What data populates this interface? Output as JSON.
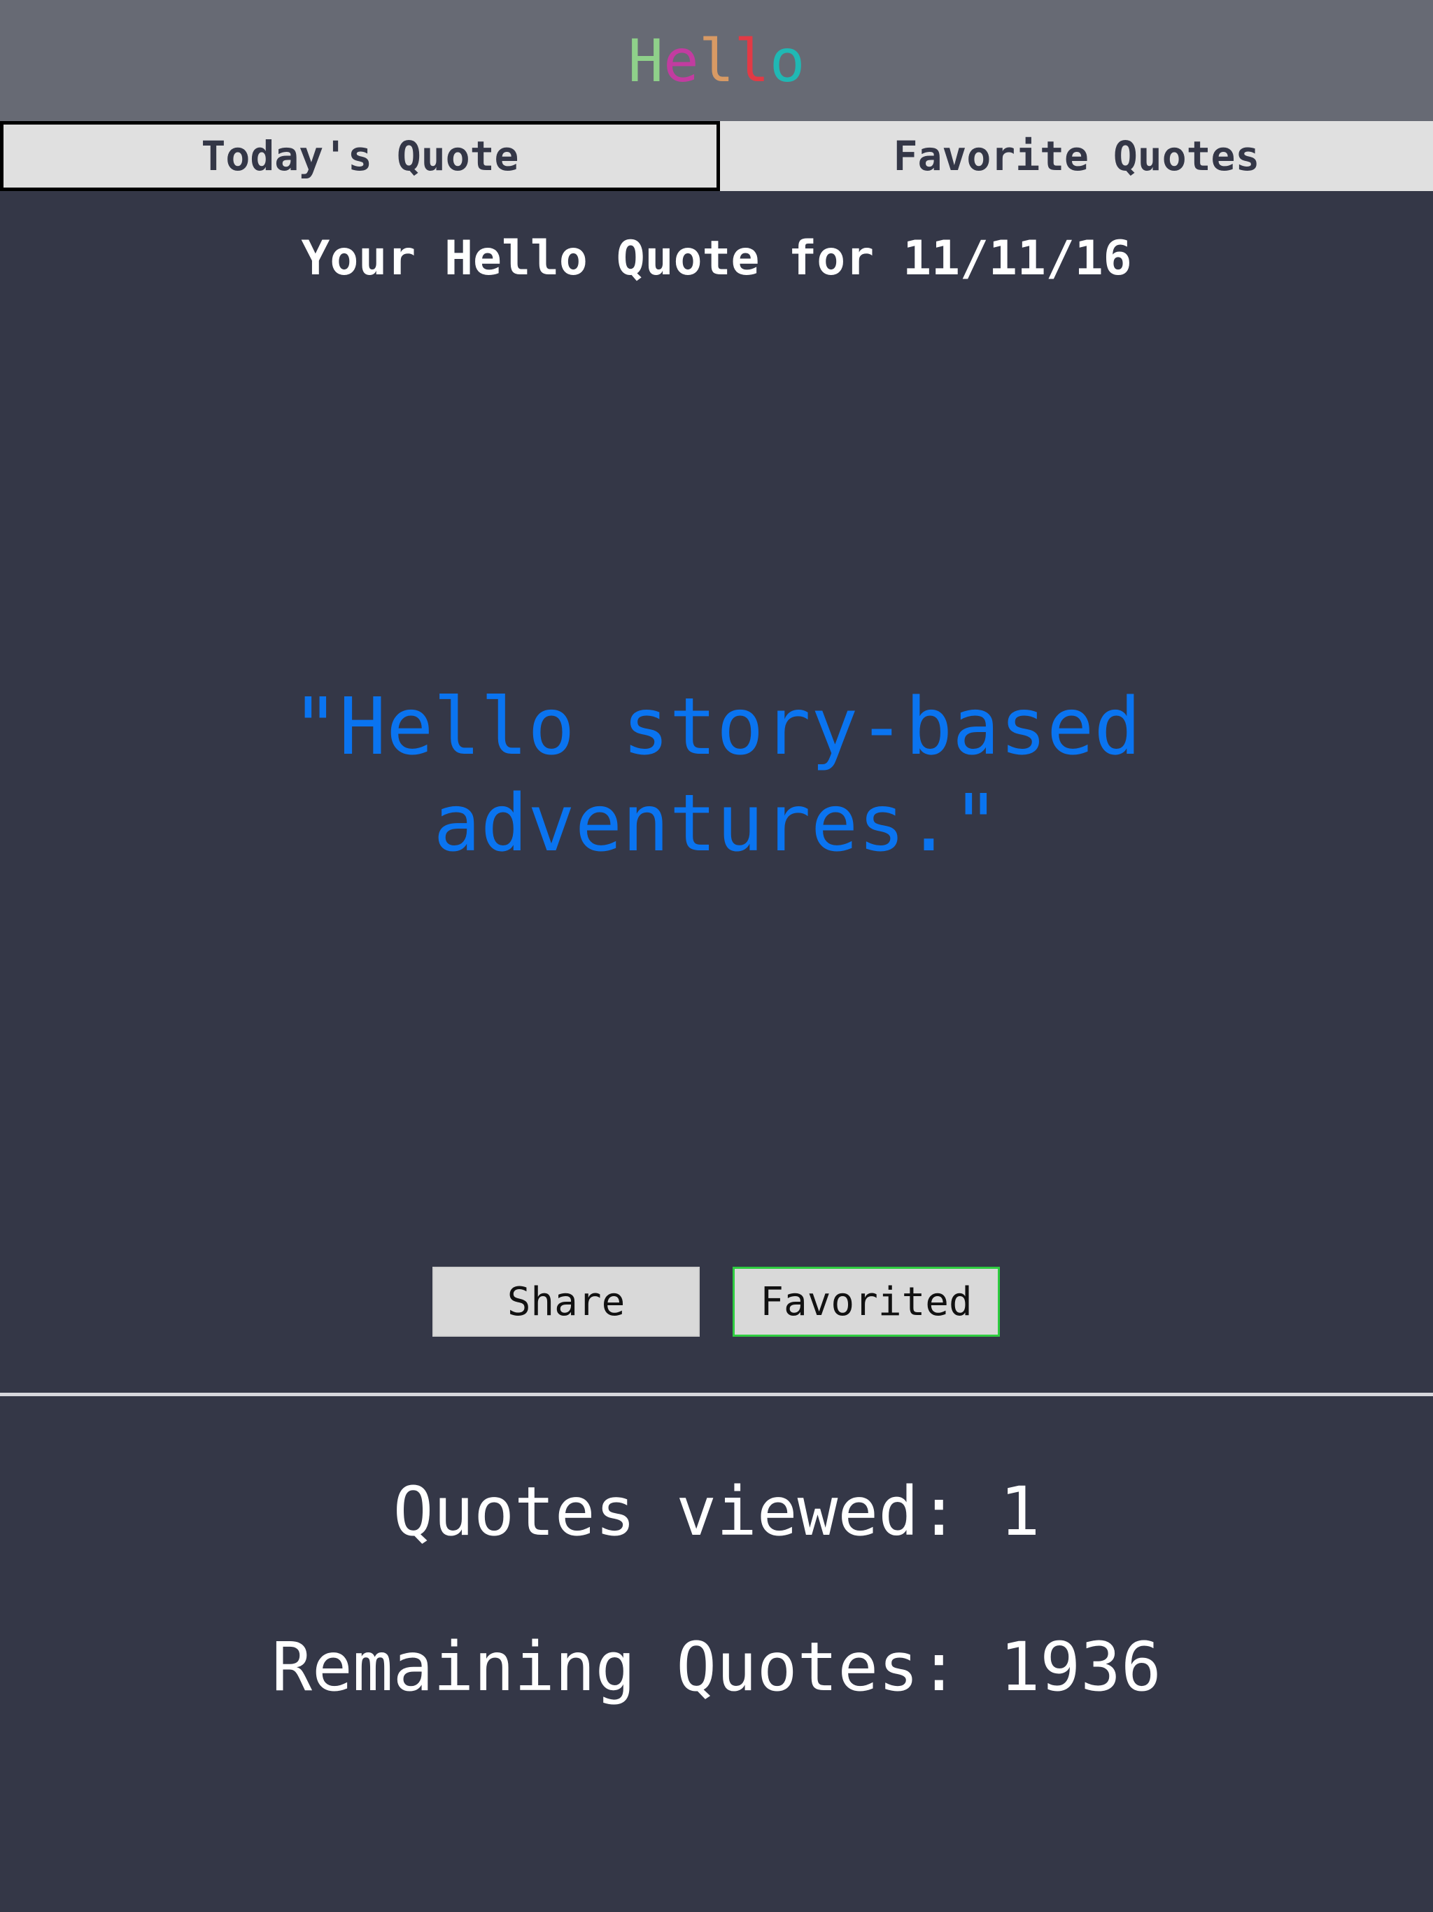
{
  "header": {
    "logo_letters": [
      {
        "char": "H",
        "color": "#8fd08a"
      },
      {
        "char": "e",
        "color": "#c23ca0"
      },
      {
        "char": "l",
        "color": "#d89a64"
      },
      {
        "char": "l",
        "color": "#e23a45"
      },
      {
        "char": "o",
        "color": "#20b8b4"
      }
    ]
  },
  "tabs": [
    {
      "label": "Today's Quote",
      "active": true
    },
    {
      "label": "Favorite Quotes",
      "active": false
    }
  ],
  "main": {
    "date_heading": "Your Hello Quote for 11/11/16",
    "quote": "\"Hello story-based adventures.\"",
    "quote_color": "#0a74f0"
  },
  "actions": {
    "share_label": "Share",
    "favorite_label": "Favorited",
    "favorite_border_color": "#2ecc40"
  },
  "stats": {
    "viewed": "Quotes viewed: 1",
    "remaining": "Remaining Quotes: 1936"
  },
  "colors": {
    "background": "#343747",
    "header_bg": "#676a74",
    "tab_bg": "#e0e0e0"
  }
}
